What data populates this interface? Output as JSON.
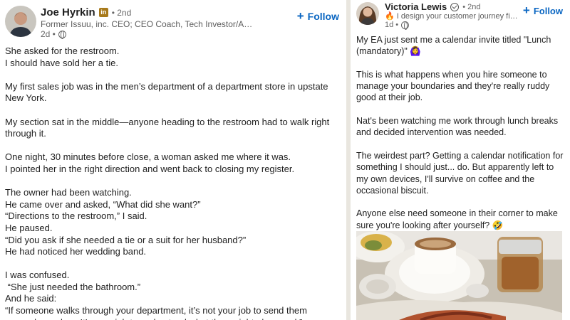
{
  "left_post": {
    "author": "Joe Hyrkin",
    "premium_badge": "in",
    "degree": "• 2nd",
    "headline": "Former Issuu, inc. CEO; CEO Coach, Tech Investor/Advisor",
    "time": "2d •",
    "follow_label": "Follow",
    "body": "She asked for the restroom.\nI should have sold her a tie.\n\nMy first sales job was in the men’s department of a department store in upstate New York.\n\nMy section sat in the middle—anyone heading to the restroom had to walk right through it.\n\nOne night, 30 minutes before close, a woman asked me where it was.\nI pointed her in the right direction and went back to closing my register.\n\nThe owner had been watching.\nHe came over and asked, “What did she want?”\n“Directions to the restroom,” I said.\nHe paused.\n“Did you ask if she needed a tie or a suit for her husband?”\nHe had noticed her wedding band.\n\nI was confused.\n “She just needed the bathroom.”\nAnd he said:\n“If someone walks through your department, it’s not your job to send them somewhere else.  It’s your job to understand what they might also need.”"
  },
  "right_post": {
    "author": "Victoria Lewis",
    "degree": "• 2nd",
    "headline": "I design your customer journey first ...",
    "time": "1d •",
    "follow_label": "Follow",
    "body": "My EA just sent me a calendar invite titled \"Lunch (mandatory)\" 🙆‍♀️\n\nThis is what happens when you hire someone to manage your boundaries and they're really ruddy good at their job.\n\nNat's been watching me work through lunch breaks and decided intervention was needed.\n\nThe weirdest part? Getting a calendar notification for something I should just... do. But apparently left to my own devices, I'll survive on coffee and the occasional biscuit.\n\nAnyone else need someone in their corner to make sure you're looking after yourself? 🤣"
  },
  "colors": {
    "link": "#0a66c2",
    "premium_badge": "#a87a1b",
    "divider": "#e9e6df"
  },
  "icons": [
    "premium-badge-icon",
    "verified-icon",
    "globe-icon",
    "plus-icon",
    "flame-icon"
  ]
}
